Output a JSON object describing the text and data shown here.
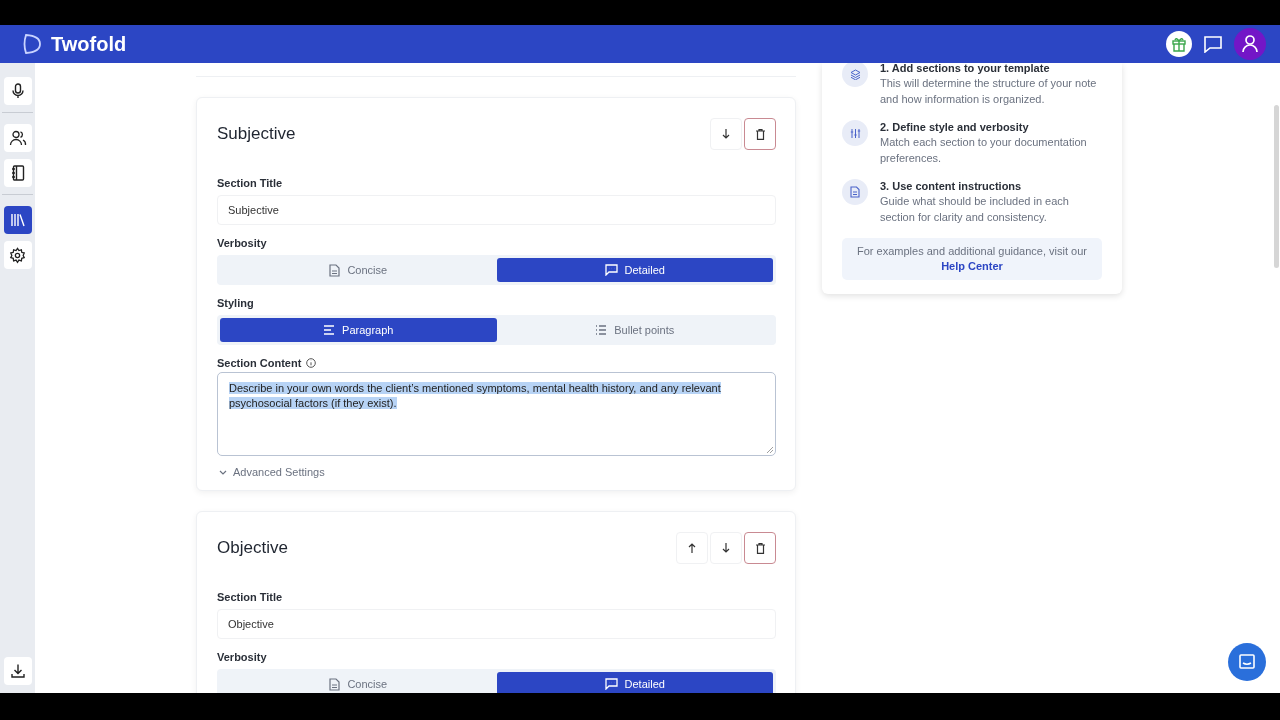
{
  "app": {
    "name": "Twofold"
  },
  "sidebar": {
    "items": [
      {
        "selected": false
      },
      {
        "selected": false
      },
      {
        "selected": false
      },
      {
        "selected": true
      },
      {
        "selected": false
      }
    ]
  },
  "sections": [
    {
      "heading": "Subjective",
      "move_up": false,
      "move_down": true,
      "title_label": "Section Title",
      "title_value": "Subjective",
      "verbosity": {
        "label": "Verbosity",
        "options": [
          {
            "label": "Concise",
            "selected": false
          },
          {
            "label": "Detailed",
            "selected": true
          }
        ]
      },
      "styling": {
        "label": "Styling",
        "options": [
          {
            "label": "Paragraph",
            "selected": true
          },
          {
            "label": "Bullet points",
            "selected": false
          }
        ]
      },
      "content": {
        "label": "Section Content",
        "value": "Describe in your own words the client’s mentioned symptoms, mental health history, and any relevant psychosocial factors (if they exist).",
        "text_selected": true
      },
      "advanced": {
        "label": "Advanced Settings",
        "expanded": false
      }
    },
    {
      "heading": "Objective",
      "move_up": true,
      "move_down": true,
      "title_label": "Section Title",
      "title_value": "Objective",
      "verbosity": {
        "label": "Verbosity",
        "options": [
          {
            "label": "Concise",
            "selected": false
          },
          {
            "label": "Detailed",
            "selected": true
          }
        ]
      }
    }
  ],
  "guide": {
    "steps": [
      {
        "title": "1. Add sections to your template",
        "text": "This will determine the structure of your note and how information is organized."
      },
      {
        "title": "2. Define style and verbosity",
        "text": "Match each section to your documentation preferences."
      },
      {
        "title": "3. Use content instructions",
        "text": "Guide what should be included in each section for clarity and consistency."
      }
    ],
    "help": {
      "text": "For examples and additional guidance, visit our",
      "link": "Help Center"
    }
  }
}
